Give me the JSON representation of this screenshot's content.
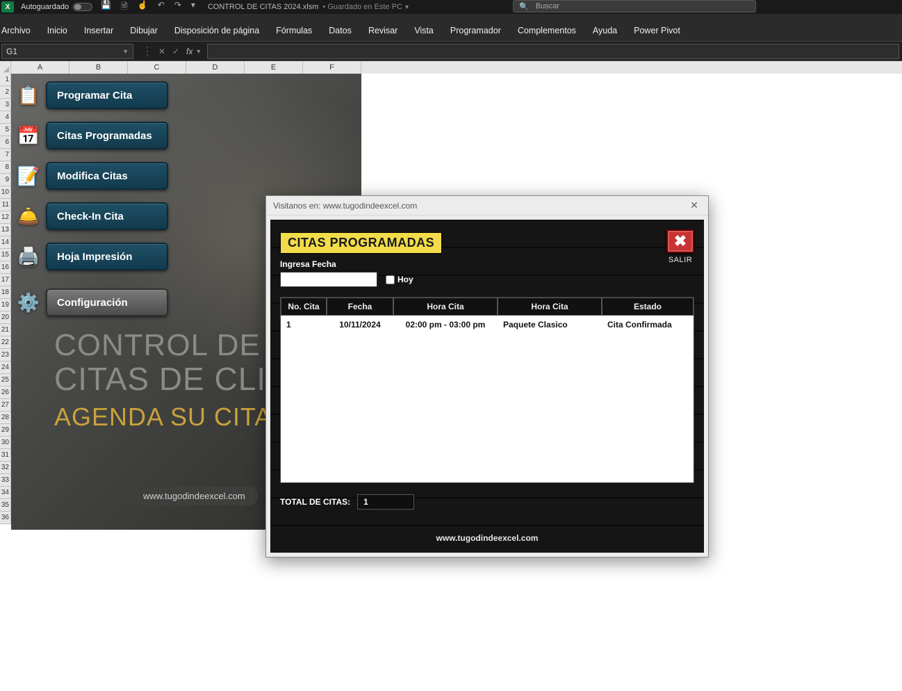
{
  "titlebar": {
    "autosave_label": "Autoguardado",
    "filename": "CONTROL DE CITAS 2024.xlsm",
    "saved_status": "Guardado en Este PC",
    "search_placeholder": "Buscar"
  },
  "ribbon": {
    "tabs": [
      "Archivo",
      "Inicio",
      "Insertar",
      "Dibujar",
      "Disposición de página",
      "Fórmulas",
      "Datos",
      "Revisar",
      "Vista",
      "Programador",
      "Complementos",
      "Ayuda",
      "Power Pivot"
    ]
  },
  "namebox": {
    "value": "G1"
  },
  "columns": [
    "A",
    "B",
    "C",
    "D",
    "E",
    "F"
  ],
  "rows": [
    "1",
    "2",
    "3",
    "4",
    "5",
    "6",
    "7",
    "8",
    "9",
    "10",
    "11",
    "12",
    "13",
    "14",
    "15",
    "16",
    "17",
    "18",
    "19",
    "20",
    "21",
    "22",
    "23",
    "24",
    "25",
    "26",
    "27",
    "28",
    "29",
    "30",
    "31",
    "32",
    "33",
    "34",
    "35",
    "36"
  ],
  "menu": {
    "items": [
      {
        "icon": "📋",
        "icon_name": "clipboard-check-icon",
        "label": "Programar Cita"
      },
      {
        "icon": "📅",
        "icon_name": "calendar-icon",
        "label": "Citas Programadas"
      },
      {
        "icon": "📝",
        "icon_name": "edit-note-icon",
        "label": "Modifica Citas"
      },
      {
        "icon": "🛎️",
        "icon_name": "bell-icon",
        "label": "Check-In Cita"
      },
      {
        "icon": "🖨️",
        "icon_name": "printer-icon",
        "label": "Hoja Impresión"
      },
      {
        "icon": "⚙️",
        "icon_name": "gear-icon",
        "label": "Configuración",
        "gray": true
      }
    ]
  },
  "hero": {
    "line1": "CONTROL DE",
    "line2": "CITAS DE CLIEN",
    "line3": "AGENDA SU CITA",
    "url": "www.tugodindeexcel.com"
  },
  "dialog": {
    "title": "Visitanos en: www.tugodindeexcel.com",
    "heading": "CITAS PROGRAMADAS",
    "ingresa_label": "Ingresa Fecha",
    "hoy_label": "Hoy",
    "salir_label": "SALIR",
    "headers": [
      "No. Cita",
      "Fecha",
      "Hora Cita",
      "Hora Cita",
      "Estado"
    ],
    "rows": [
      {
        "no": "1",
        "fecha": "10/11/2024",
        "hora": "02:00 pm - 03:00 pm",
        "servicio": "Paquete Clasico",
        "estado": "Cita Confirmada"
      }
    ],
    "total_label": "TOTAL DE CITAS:",
    "total_value": "1",
    "footer": "www.tugodindeexcel.com"
  }
}
